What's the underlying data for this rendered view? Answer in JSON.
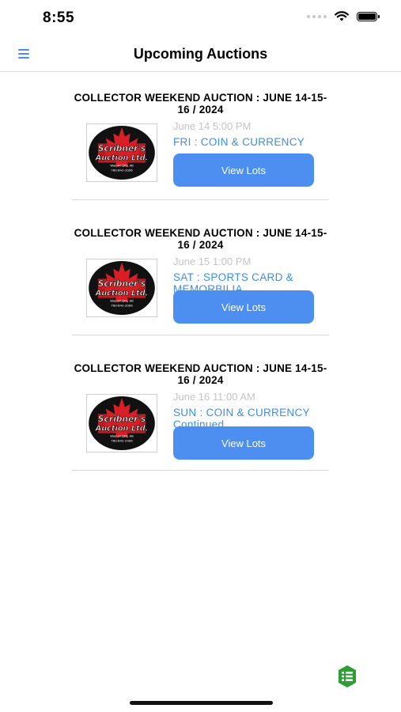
{
  "status": {
    "time": "8:55"
  },
  "nav": {
    "title": "Upcoming Auctions",
    "menu_icon": "hamburger-menu-icon"
  },
  "auctions": [
    {
      "title": "COLLECTOR WEEKEND AUCTION : JUNE 14-15-16 / 2024",
      "date": "June 14 5:00 PM",
      "session": "FRI : COIN & CURRENCY",
      "button_label": "View Lots"
    },
    {
      "title": "COLLECTOR WEEKEND AUCTION : JUNE 14-15-16 / 2024",
      "date": "June 15 1:00 PM",
      "session": "SAT : SPORTS CARD & MEMORBILIA",
      "button_label": "View Lots"
    },
    {
      "title": "COLLECTOR WEEKEND AUCTION : JUNE 14-15-16 / 2024",
      "date": "June 16 11:00 AM",
      "session": "SUN : COIN & CURRENCY Continued",
      "button_label": "View Lots"
    }
  ],
  "logo": {
    "line1": "Scribner's",
    "line2": "Auction Ltd.",
    "line3": "Wainwright, AB",
    "line4": "780-842-2006"
  },
  "colors": {
    "accent": "#4c8ff0",
    "session_text": "#3d8ee6",
    "date_text": "#c4c4c4",
    "logo_red": "#d81f26",
    "fab_green": "#2f9e36"
  }
}
